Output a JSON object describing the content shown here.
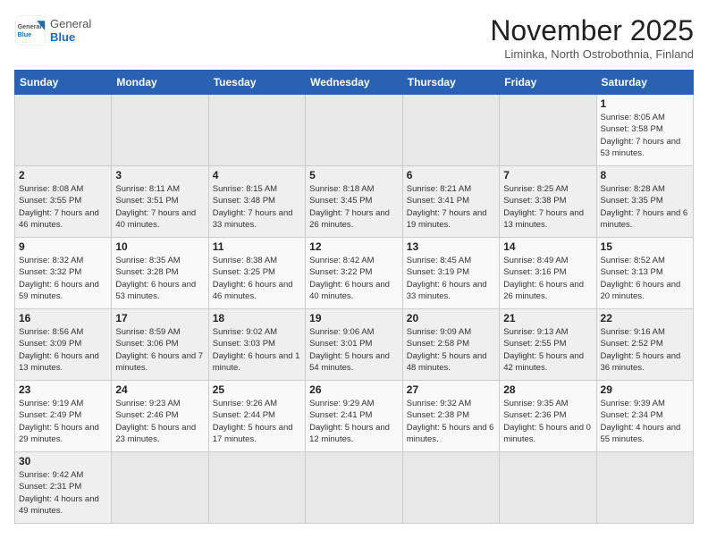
{
  "header": {
    "logo_general": "General",
    "logo_blue": "Blue",
    "title": "November 2025",
    "subtitle": "Liminka, North Ostrobothnia, Finland"
  },
  "days_of_week": [
    "Sunday",
    "Monday",
    "Tuesday",
    "Wednesday",
    "Thursday",
    "Friday",
    "Saturday"
  ],
  "weeks": [
    [
      {
        "day": "",
        "info": ""
      },
      {
        "day": "",
        "info": ""
      },
      {
        "day": "",
        "info": ""
      },
      {
        "day": "",
        "info": ""
      },
      {
        "day": "",
        "info": ""
      },
      {
        "day": "",
        "info": ""
      },
      {
        "day": "1",
        "info": "Sunrise: 8:05 AM\nSunset: 3:58 PM\nDaylight: 7 hours\nand 53 minutes."
      }
    ],
    [
      {
        "day": "2",
        "info": "Sunrise: 8:08 AM\nSunset: 3:55 PM\nDaylight: 7 hours\nand 46 minutes."
      },
      {
        "day": "3",
        "info": "Sunrise: 8:11 AM\nSunset: 3:51 PM\nDaylight: 7 hours\nand 40 minutes."
      },
      {
        "day": "4",
        "info": "Sunrise: 8:15 AM\nSunset: 3:48 PM\nDaylight: 7 hours\nand 33 minutes."
      },
      {
        "day": "5",
        "info": "Sunrise: 8:18 AM\nSunset: 3:45 PM\nDaylight: 7 hours\nand 26 minutes."
      },
      {
        "day": "6",
        "info": "Sunrise: 8:21 AM\nSunset: 3:41 PM\nDaylight: 7 hours\nand 19 minutes."
      },
      {
        "day": "7",
        "info": "Sunrise: 8:25 AM\nSunset: 3:38 PM\nDaylight: 7 hours\nand 13 minutes."
      },
      {
        "day": "8",
        "info": "Sunrise: 8:28 AM\nSunset: 3:35 PM\nDaylight: 7 hours\nand 6 minutes."
      }
    ],
    [
      {
        "day": "9",
        "info": "Sunrise: 8:32 AM\nSunset: 3:32 PM\nDaylight: 6 hours\nand 59 minutes."
      },
      {
        "day": "10",
        "info": "Sunrise: 8:35 AM\nSunset: 3:28 PM\nDaylight: 6 hours\nand 53 minutes."
      },
      {
        "day": "11",
        "info": "Sunrise: 8:38 AM\nSunset: 3:25 PM\nDaylight: 6 hours\nand 46 minutes."
      },
      {
        "day": "12",
        "info": "Sunrise: 8:42 AM\nSunset: 3:22 PM\nDaylight: 6 hours\nand 40 minutes."
      },
      {
        "day": "13",
        "info": "Sunrise: 8:45 AM\nSunset: 3:19 PM\nDaylight: 6 hours\nand 33 minutes."
      },
      {
        "day": "14",
        "info": "Sunrise: 8:49 AM\nSunset: 3:16 PM\nDaylight: 6 hours\nand 26 minutes."
      },
      {
        "day": "15",
        "info": "Sunrise: 8:52 AM\nSunset: 3:13 PM\nDaylight: 6 hours\nand 20 minutes."
      }
    ],
    [
      {
        "day": "16",
        "info": "Sunrise: 8:56 AM\nSunset: 3:09 PM\nDaylight: 6 hours\nand 13 minutes."
      },
      {
        "day": "17",
        "info": "Sunrise: 8:59 AM\nSunset: 3:06 PM\nDaylight: 6 hours\nand 7 minutes."
      },
      {
        "day": "18",
        "info": "Sunrise: 9:02 AM\nSunset: 3:03 PM\nDaylight: 6 hours\nand 1 minute."
      },
      {
        "day": "19",
        "info": "Sunrise: 9:06 AM\nSunset: 3:01 PM\nDaylight: 5 hours\nand 54 minutes."
      },
      {
        "day": "20",
        "info": "Sunrise: 9:09 AM\nSunset: 2:58 PM\nDaylight: 5 hours\nand 48 minutes."
      },
      {
        "day": "21",
        "info": "Sunrise: 9:13 AM\nSunset: 2:55 PM\nDaylight: 5 hours\nand 42 minutes."
      },
      {
        "day": "22",
        "info": "Sunrise: 9:16 AM\nSunset: 2:52 PM\nDaylight: 5 hours\nand 36 minutes."
      }
    ],
    [
      {
        "day": "23",
        "info": "Sunrise: 9:19 AM\nSunset: 2:49 PM\nDaylight: 5 hours\nand 29 minutes."
      },
      {
        "day": "24",
        "info": "Sunrise: 9:23 AM\nSunset: 2:46 PM\nDaylight: 5 hours\nand 23 minutes."
      },
      {
        "day": "25",
        "info": "Sunrise: 9:26 AM\nSunset: 2:44 PM\nDaylight: 5 hours\nand 17 minutes."
      },
      {
        "day": "26",
        "info": "Sunrise: 9:29 AM\nSunset: 2:41 PM\nDaylight: 5 hours\nand 12 minutes."
      },
      {
        "day": "27",
        "info": "Sunrise: 9:32 AM\nSunset: 2:38 PM\nDaylight: 5 hours\nand 6 minutes."
      },
      {
        "day": "28",
        "info": "Sunrise: 9:35 AM\nSunset: 2:36 PM\nDaylight: 5 hours\nand 0 minutes."
      },
      {
        "day": "29",
        "info": "Sunrise: 9:39 AM\nSunset: 2:34 PM\nDaylight: 4 hours\nand 55 minutes."
      }
    ],
    [
      {
        "day": "30",
        "info": "Sunrise: 9:42 AM\nSunset: 2:31 PM\nDaylight: 4 hours\nand 49 minutes."
      },
      {
        "day": "",
        "info": ""
      },
      {
        "day": "",
        "info": ""
      },
      {
        "day": "",
        "info": ""
      },
      {
        "day": "",
        "info": ""
      },
      {
        "day": "",
        "info": ""
      },
      {
        "day": "",
        "info": ""
      }
    ]
  ]
}
